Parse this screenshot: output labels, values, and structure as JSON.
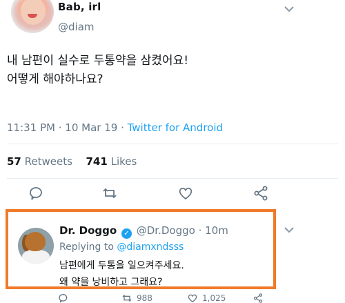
{
  "tweet": {
    "author_name": "Bab, irl",
    "author_handle": "@diam",
    "text_line1": "내 남편이 실수로 두통약을 삼켰어요!",
    "text_line2": "어떻게 해야하나요?",
    "timestamp": "11:31 PM · 10 Mar 19 · ",
    "via": "Twitter for Android",
    "retweets_count": "57",
    "retweets_label": "Retweets",
    "likes_count": "741",
    "likes_label": "Likes"
  },
  "reply": {
    "author_name": "Dr. Doggo",
    "author_handle": "@Dr.Doggo",
    "time": "· 10m",
    "replying_prefix": "Replying to ",
    "replying_to": "@diamxndsss",
    "text_line1": "남편에게 두통을 일으켜주세요.",
    "text_line2": "왜 약을 낭비하고 그래요?",
    "retweets": "988",
    "likes": "1,025"
  },
  "colors": {
    "accent": "#1da1f2",
    "highlight_border": "#f07a2a",
    "muted": "#657786"
  },
  "icons": {
    "actions": [
      "reply-icon",
      "retweet-icon",
      "like-icon",
      "share-icon"
    ],
    "menu": "chevron-down-icon",
    "verified": "verified-badge-icon"
  }
}
